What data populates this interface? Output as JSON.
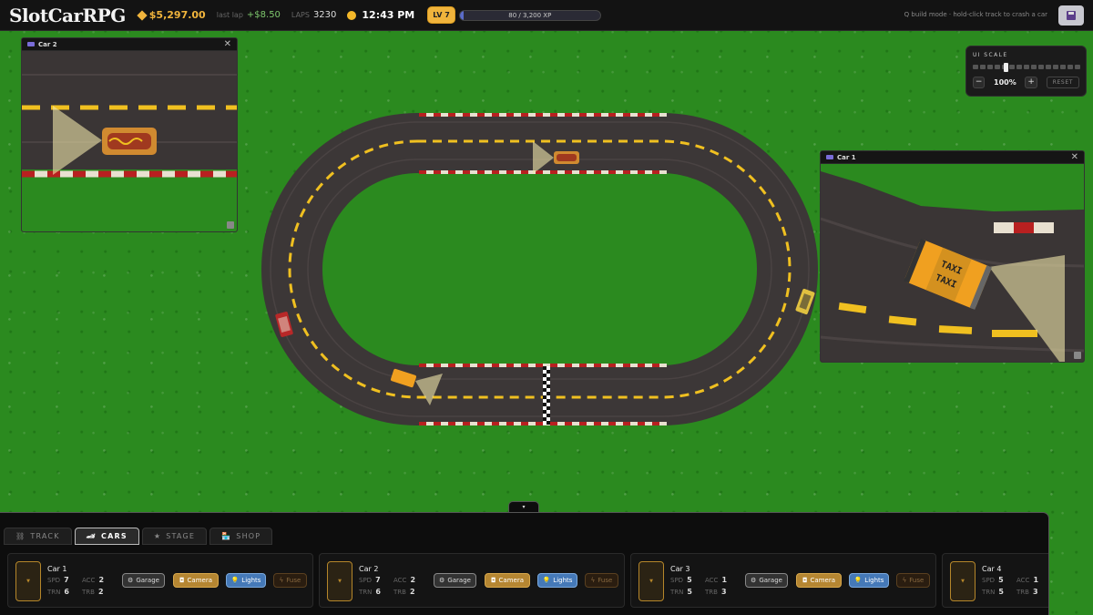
{
  "header": {
    "logo": "SlotCarRPG",
    "money": "$5,297.00",
    "last_lap_label": "last lap",
    "last_lap_value": "+$8.50",
    "laps_label": "LAPS",
    "laps_value": "3230",
    "time": "12:43 PM",
    "level": "LV 7",
    "xp_text": "80 / 3,200 XP",
    "xp_fraction": 0.025,
    "hint": "Q build mode · hold-click track to crash a car"
  },
  "camera_windows": [
    {
      "title": "Car 2"
    },
    {
      "title": "Car 1"
    }
  ],
  "ui_scale": {
    "title": "UI SCALE",
    "value": "100%",
    "minus": "−",
    "plus": "+",
    "reset": "RESET",
    "level_fraction": 0.3
  },
  "panel": {
    "collapse": "▾",
    "tabs": [
      {
        "icon": "⛓",
        "label": "TRACK",
        "active": false
      },
      {
        "icon": "🏎",
        "label": "CARS",
        "active": true
      },
      {
        "icon": "★",
        "label": "STAGE",
        "active": false
      },
      {
        "icon": "🏪",
        "label": "SHOP",
        "active": false
      }
    ],
    "buttons": {
      "garage": "Garage",
      "camera": "Camera",
      "lights": "Lights",
      "fuse": "Fuse"
    },
    "stat_labels": {
      "spd": "SPD",
      "acc": "ACC",
      "trn": "TRN",
      "trb": "TRB"
    },
    "cars": [
      {
        "name": "Car 1",
        "spd": "7",
        "acc": "2",
        "trn": "6",
        "trb": "2"
      },
      {
        "name": "Car 2",
        "spd": "7",
        "acc": "2",
        "trn": "6",
        "trb": "2"
      },
      {
        "name": "Car 3",
        "spd": "5",
        "acc": "1",
        "trn": "5",
        "trb": "3"
      },
      {
        "name": "Car 4",
        "spd": "5",
        "acc": "1",
        "trn": "5",
        "trb": "3"
      }
    ]
  }
}
